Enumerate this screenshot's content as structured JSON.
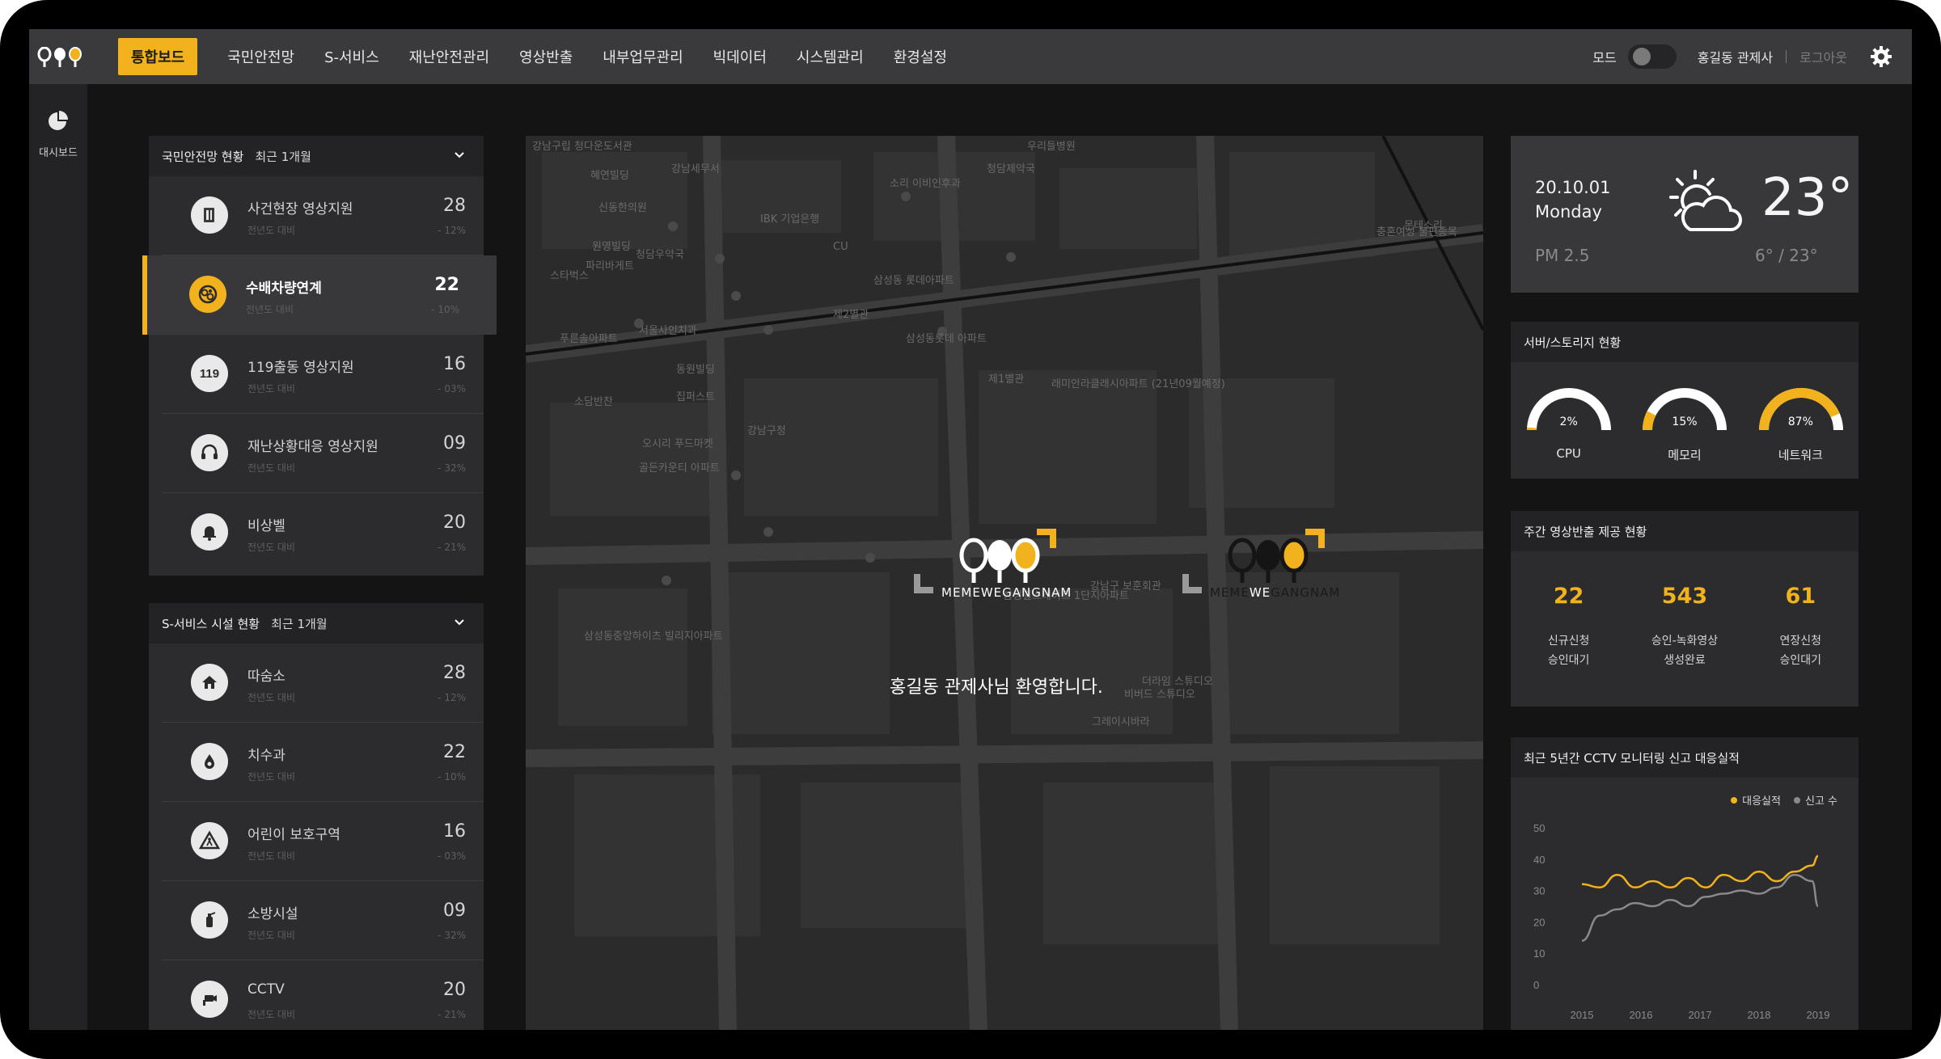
{
  "nav": {
    "items": [
      "통합보드",
      "국민안전망",
      "S-서비스",
      "재난안전관리",
      "영상반출",
      "내부업무관리",
      "빅데이터",
      "시스템관리",
      "환경설정"
    ],
    "active_index": 0,
    "mode_label": "모드",
    "user": "홍길동 관제사",
    "logout": "로그아웃",
    "icons": {
      "logo": "logo-icon",
      "settings": "gear-icon"
    }
  },
  "sidebar": {
    "label": "대시보드",
    "icon": "dashboard-pie-icon"
  },
  "safety_panel": {
    "title": "국민안전망 현황",
    "period": "최근 1개월",
    "items": [
      {
        "name": "사건현장 영상지원",
        "compare": "전년도 대비",
        "value": "28",
        "pct": "- 12%",
        "icon": "mobile-icon"
      },
      {
        "name": "수배차량연계",
        "compare": "전년도 대비",
        "value": "22",
        "pct": "- 10%",
        "icon": "wanted-vehicle-icon"
      },
      {
        "name": "119출동 영상지원",
        "compare": "전년도 대비",
        "value": "16",
        "pct": "- 03%",
        "icon": "119-icon"
      },
      {
        "name": "재난상황대응 영상지원",
        "compare": "전년도 대비",
        "value": "09",
        "pct": "- 32%",
        "icon": "headset-icon"
      },
      {
        "name": "비상벨",
        "compare": "전년도 대비",
        "value": "20",
        "pct": "- 21%",
        "icon": "bell-icon"
      }
    ]
  },
  "service_panel": {
    "title": "S-서비스 시설 현황",
    "period": "최근 1개월",
    "items": [
      {
        "name": "따숨소",
        "compare": "전년도 대비",
        "value": "28",
        "pct": "- 12%",
        "icon": "house-icon"
      },
      {
        "name": "치수과",
        "compare": "전년도 대비",
        "value": "22",
        "pct": "- 10%",
        "icon": "water-drop-icon"
      },
      {
        "name": "어린이 보호구역",
        "compare": "전년도 대비",
        "value": "16",
        "pct": "- 03%",
        "icon": "child-warning-icon"
      },
      {
        "name": "소방시설",
        "compare": "전년도 대비",
        "value": "09",
        "pct": "- 32%",
        "icon": "fire-extinguisher-icon"
      },
      {
        "name": "CCTV",
        "compare": "전년도 대비",
        "value": "20",
        "pct": "- 21%",
        "icon": "cctv-icon"
      }
    ]
  },
  "map": {
    "logo1": "MEMEWEGANGNAM",
    "logo2_a": "MEME",
    "logo2_b": "WE",
    "logo2_c": "GANGNAM",
    "welcome_name": "홍길동 관제사",
    "welcome_suffix": "님 환영합니다.",
    "labels": [
      "강남구립 청다운도서관",
      "강남세무서",
      "소리 이비인후과",
      "청담제약국",
      "우리들병원",
      "혜연빌딩",
      "신동한의원",
      "IBK 기업은행",
      "원영빌딩",
      "파리바게트",
      "청담우약국",
      "스타벅스",
      "CU",
      "삼성동 롯데아파트",
      "제2별관",
      "푸른솔아파트",
      "서울사인치과",
      "동원빌딩",
      "집퍼스트",
      "소담반찬",
      "강남구청",
      "오시리 푸드마켓",
      "골든카운티 아파트",
      "삼성동롯데 아파트",
      "제1별관",
      "래미안라클래시아파트 (21년09월예정)",
      "삼성힐스테이트 1단지아파트",
      "삼성동중앙하이츠 빌리지아파트",
      "강남구 보훈회관",
      "비버드 스튜디오",
      "더라임 스튜디오",
      "그레이시바라",
      "몬테소리",
      "충혼여성 불편종목"
    ]
  },
  "weather": {
    "date": "20.10.01",
    "day": "Monday",
    "pm": "PM 2.5",
    "temp": "23°",
    "range": "6°  /  23°",
    "icon": "sun-cloud-icon"
  },
  "server": {
    "title": "서버/스토리지 현황",
    "gauges": [
      {
        "label": "CPU",
        "value": "2%",
        "fraction": 0.02
      },
      {
        "label": "메모리",
        "value": "15%",
        "fraction": 0.15
      },
      {
        "label": "네트워크",
        "value": "87%",
        "fraction": 0.87
      }
    ]
  },
  "weekly": {
    "title": "주간 영상반출 제공 현황",
    "stats": [
      {
        "value": "22",
        "line1": "신규신청",
        "line2": "승인대기"
      },
      {
        "value": "543",
        "line1": "승인-녹화영상",
        "line2": "생성완료"
      },
      {
        "value": "61",
        "line1": "연장신청",
        "line2": "승인대기"
      }
    ]
  },
  "cctv": {
    "title": "최근 5년간 CCTV 모니터링 신고 대응실적",
    "legend": [
      "대응실적",
      "신고 수"
    ]
  },
  "colors": {
    "accent": "#f2b21d",
    "panel": "#2c2c2e",
    "header": "#232325",
    "series_response": "#f2b21d",
    "series_reports": "#8a8a8a"
  },
  "chart_data": {
    "type": "line",
    "title": "최근 5년간 CCTV 모니터링 신고 대응실적",
    "xlabel": "",
    "ylabel": "",
    "x_ticks": [
      "2015",
      "2016",
      "2017",
      "2018",
      "2019"
    ],
    "y_ticks": [
      "0",
      "10",
      "20",
      "30",
      "40",
      "50"
    ],
    "ylim": [
      0,
      50
    ],
    "xlim": [
      2015,
      2019
    ],
    "grid": false,
    "legend_position": "top-right",
    "series": [
      {
        "name": "대응실적",
        "x": [
          2015.0,
          2015.3,
          2015.6,
          2015.9,
          2016.2,
          2016.5,
          2016.8,
          2017.1,
          2017.4,
          2017.7,
          2018.0,
          2018.3,
          2018.6,
          2018.9,
          2019.0
        ],
        "values": [
          32,
          31,
          35,
          31,
          33,
          31,
          34,
          31,
          35,
          33,
          36,
          33,
          36,
          38,
          41
        ]
      },
      {
        "name": "신고 수",
        "x": [
          2015.0,
          2015.3,
          2015.6,
          2015.9,
          2016.2,
          2016.5,
          2016.8,
          2017.1,
          2017.4,
          2017.7,
          2018.0,
          2018.3,
          2018.6,
          2018.9,
          2019.0
        ],
        "values": [
          14,
          22,
          24,
          26,
          25,
          27,
          25,
          28,
          29,
          30,
          29,
          31,
          35,
          33,
          25
        ]
      }
    ]
  }
}
